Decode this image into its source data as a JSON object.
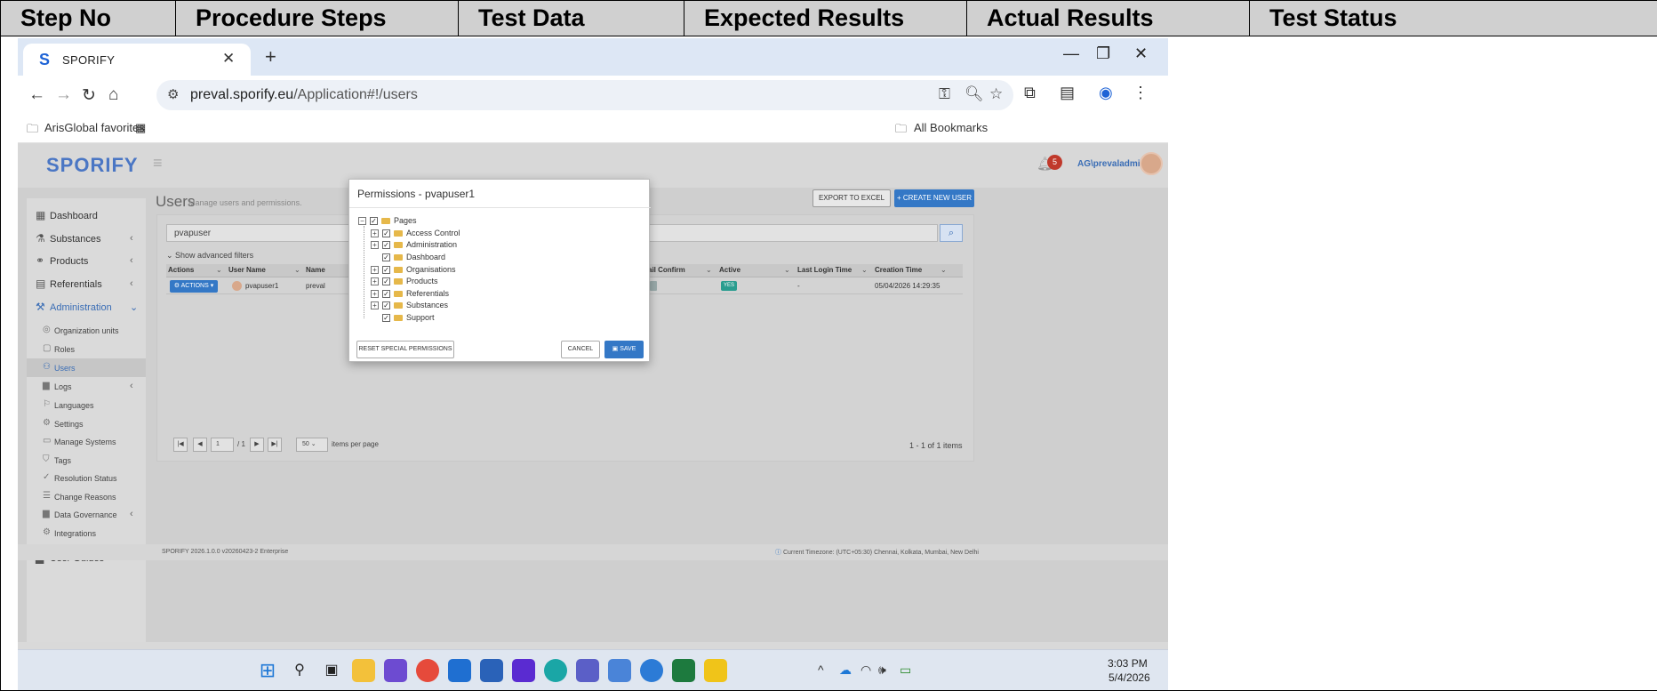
{
  "table": {
    "headers": [
      "Step No",
      "Procedure Steps",
      "Test Data",
      "Expected Results",
      "Actual Results",
      "Test Status"
    ]
  },
  "browser": {
    "tab_title": "SPORIFY",
    "tab_logo": "S",
    "url_host": "preval.sporify.eu",
    "url_path": "/Application#!/users",
    "bookmark_favorites": "ArisGlobal favorites",
    "bookmark_all": "All Bookmarks"
  },
  "app": {
    "logo": "SPORIFY",
    "notification_count": "5",
    "current_user": "AG\\prevaladmin1",
    "sidebar": {
      "dashboard": "Dashboard",
      "substances": "Substances",
      "products": "Products",
      "referentials": "Referentials",
      "administration": "Administration",
      "org_units": "Organization units",
      "roles": "Roles",
      "users": "Users",
      "logs": "Logs",
      "languages": "Languages",
      "settings": "Settings",
      "manage_systems": "Manage Systems",
      "tags": "Tags",
      "resolution_status": "Resolution Status",
      "change_reasons": "Change Reasons",
      "data_governance": "Data Governance",
      "integrations": "Integrations",
      "user_guides": "User Guides"
    },
    "page_title": "Users",
    "page_subtitle": "Manage users and permissions.",
    "export_label": "EXPORT TO EXCEL",
    "create_label": "+ CREATE NEW USER",
    "search_value": "pvapuser",
    "advanced_filters": "Show advanced filters",
    "grid": {
      "columns": {
        "actions": "Actions",
        "user_name": "User Name",
        "name": "Name",
        "email_confirm": "ail Confirm",
        "active": "Active",
        "last_login": "Last Login Time",
        "creation_time": "Creation Time"
      },
      "row": {
        "actions_button": "ACTIONS",
        "user_name": "pvapuser1",
        "name": "preval",
        "active": "YES",
        "last_login": "-",
        "creation_time": "05/04/2026 14:29:35"
      }
    },
    "pager": {
      "page": "1",
      "of_pages": "/ 1",
      "page_size": "50",
      "items_per_page": "items per page",
      "items_count": "1 - 1 of 1 items"
    },
    "footer_version": "SPORIFY 2026.1.0.0 v20260423-2 Enterprise",
    "footer_timezone": "Current Timezone: (UTC+05:30) Chennai, Kolkata, Mumbai, New Delhi"
  },
  "modal": {
    "title": "Permissions - pvapuser1",
    "tree": {
      "root": "Pages",
      "children": [
        "Access Control",
        "Administration",
        "Dashboard",
        "Organisations",
        "Products",
        "Referentials",
        "Substances",
        "Support"
      ]
    },
    "reset_label": "RESET SPECIAL PERMISSIONS",
    "cancel_label": "CANCEL",
    "save_label": "SAVE"
  },
  "taskbar": {
    "time": "3:03 PM",
    "date": "5/4/2026"
  },
  "colors": {
    "accent": "#3478c6",
    "header_gray": "#d0d0d0",
    "badge_red": "#c0392b",
    "yes_green": "#2a9d8f"
  }
}
